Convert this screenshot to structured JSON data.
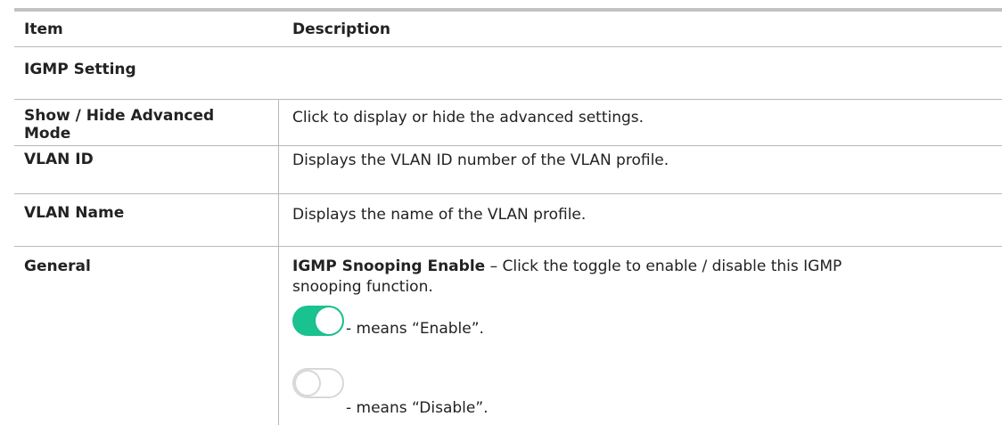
{
  "header": {
    "item": "Item",
    "description": "Description"
  },
  "section_title": "IGMP Setting",
  "rows": [
    {
      "item_line1": "Show / Hide Advanced",
      "item_line2": "Mode",
      "description": "Click to display or hide the advanced settings."
    },
    {
      "item": "VLAN ID",
      "description": "Displays the VLAN ID number of the VLAN profile."
    },
    {
      "item": "VLAN Name",
      "description": "Displays the name of the VLAN profile."
    },
    {
      "item": "General",
      "description_bold": "IGMP Snooping Enable",
      "description_line1": " – Click the toggle to enable / disable this IGMP",
      "description_line2": "snooping function.",
      "toggle_enable_text": "- means “Enable”.",
      "toggle_disable_text": "- means “Disable”."
    }
  ],
  "colors": {
    "toggle_on": "#19c28f",
    "toggle_off_border": "#d8d8d8",
    "rule": "#b8b8b8",
    "top_rule": "#c2c2c2"
  },
  "icons": {
    "toggle_on": "toggle-on-icon",
    "toggle_off": "toggle-off-icon"
  }
}
